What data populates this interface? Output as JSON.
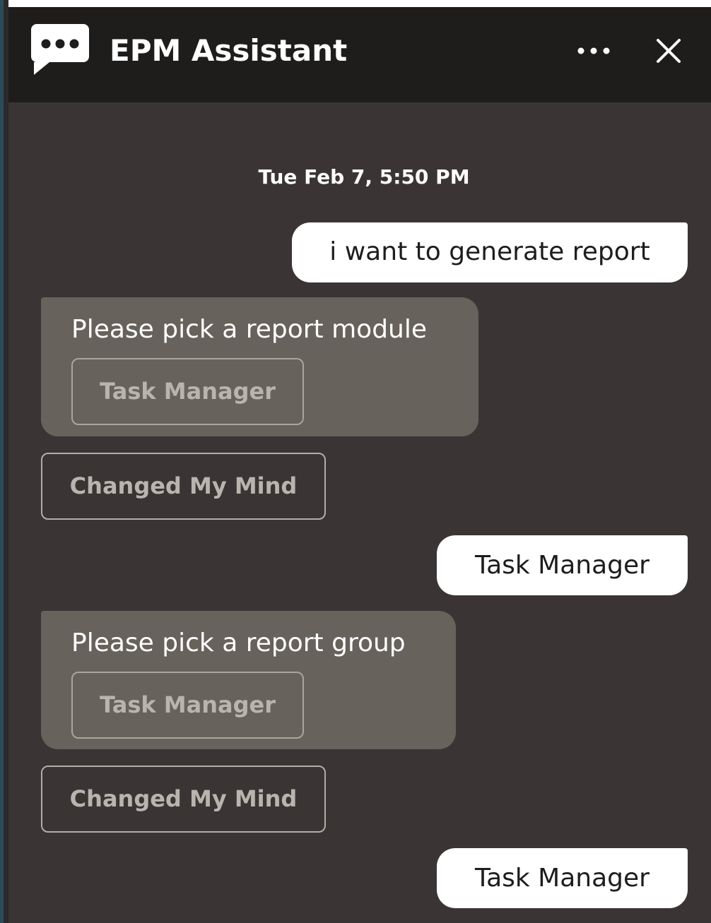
{
  "header": {
    "title": "EPM Assistant",
    "logo_icon": "chat-bubble-icon",
    "more_icon": "more-horizontal-icon",
    "close_icon": "close-icon"
  },
  "conversation": {
    "timestamp": "Tue Feb 7, 5:50 PM",
    "messages": [
      {
        "role": "user",
        "text": "i want to generate report"
      },
      {
        "role": "bot",
        "text": "Please pick a report module",
        "choices": [
          "Task Manager"
        ],
        "cancel_label": "Changed My Mind"
      },
      {
        "role": "user",
        "text": "Task Manager"
      },
      {
        "role": "bot",
        "text": "Please pick a report group",
        "choices": [
          "Task Manager"
        ],
        "cancel_label": "Changed My Mind"
      },
      {
        "role": "user",
        "text": "Task Manager"
      }
    ]
  },
  "colors": {
    "header_bg": "#1f1d1c",
    "chat_bg": "#3a3534",
    "bot_card_bg": "#67625b",
    "user_bubble_bg": "#ffffff",
    "text_light": "#ffffff",
    "button_text": "#b8b4ae"
  }
}
